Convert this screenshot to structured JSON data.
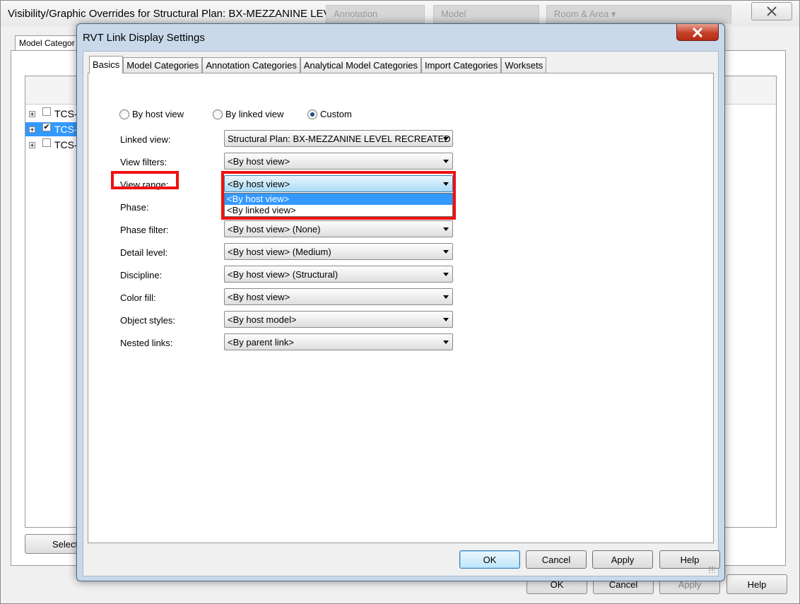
{
  "parent_window": {
    "title": "Visibility/Graphic Overrides for Structural Plan: BX-MEZZANINE LEVEL NEW",
    "ghost_ribbon": [
      "Annotation",
      "Model",
      "Room & Area ▾"
    ],
    "first_tab": "Model Categor",
    "tree_rows": [
      {
        "label": "TCS-",
        "checked": false,
        "selected": false
      },
      {
        "label": "TCS-",
        "checked": true,
        "selected": true
      },
      {
        "label": "TCS-",
        "checked": false,
        "selected": false
      }
    ],
    "select_button": "Select",
    "bottom_buttons": {
      "ok": "OK",
      "cancel": "Cancel",
      "apply": "Apply",
      "help": "Help"
    }
  },
  "dialog": {
    "title": "RVT Link Display Settings",
    "tabs": [
      "Basics",
      "Model Categories",
      "Annotation Categories",
      "Analytical Model Categories",
      "Import Categories",
      "Worksets"
    ],
    "active_tab": "Basics",
    "radios": {
      "by_host_view": "By host view",
      "by_linked_view": "By linked view",
      "custom": "Custom",
      "selected": "Custom"
    },
    "fields": {
      "linked_view": {
        "label": "Linked view:",
        "value": "Structural Plan: BX-MEZZANINE LEVEL RECREATED"
      },
      "view_filters": {
        "label": "View filters:",
        "value": "<By host view>"
      },
      "view_range": {
        "label": "View range:",
        "value": "<By host view>"
      },
      "phase": {
        "label": "Phase:"
      },
      "phase_filter": {
        "label": "Phase filter:",
        "value": "<By host view> (None)"
      },
      "detail_level": {
        "label": "Detail level:",
        "value": "<By host view> (Medium)"
      },
      "discipline": {
        "label": "Discipline:",
        "value": "<By host view> (Structural)"
      },
      "color_fill": {
        "label": "Color fill:",
        "value": "<By host view>"
      },
      "object_styles": {
        "label": "Object styles:",
        "value": "<By host model>"
      },
      "nested_links": {
        "label": "Nested links:",
        "value": "<By parent link>"
      }
    },
    "view_range_options": [
      "<By host view>",
      "<By linked view>"
    ],
    "buttons": {
      "ok": "OK",
      "cancel": "Cancel",
      "apply": "Apply",
      "help": "Help"
    }
  },
  "colors": {
    "highlight": "#ee1111",
    "selection": "#3399ff"
  }
}
